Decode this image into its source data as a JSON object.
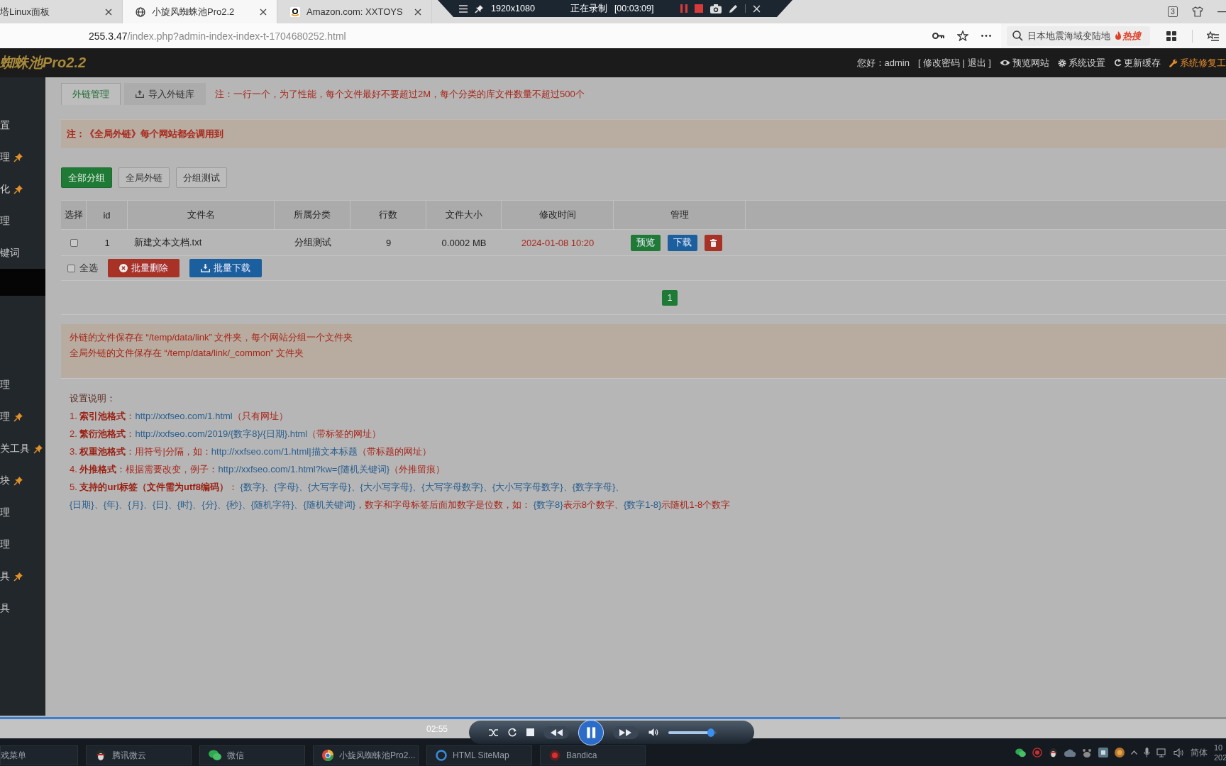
{
  "browser": {
    "tabs": [
      {
        "title": "塔Linux面板",
        "kind": "plain",
        "selected": false
      },
      {
        "title": "小旋风蜘蛛池Pro2.2",
        "kind": "web",
        "selected": true
      },
      {
        "title": "Amazon.com: XXTOYS",
        "kind": "store",
        "selected": false
      }
    ],
    "address": {
      "host": "255.3.47",
      "path": "/index.php?admin-index-index-t-1704680252.html"
    },
    "search": {
      "value": "日本地震海域变陆地",
      "hot_label": "热搜"
    },
    "window_badge": "3"
  },
  "recorder": {
    "resolution": "1920x1080",
    "status": "正在录制",
    "elapsed": "[00:03:09]"
  },
  "admin": {
    "logo": "蜘蛛池Pro2.2",
    "greeting": "您好：admin",
    "account": "[ 修改密码 | 退出 ]",
    "links": [
      {
        "kind": "preview",
        "label": "预览网站"
      },
      {
        "kind": "settings",
        "label": "系统设置"
      },
      {
        "kind": "refresh",
        "label": "更新缓存"
      },
      {
        "kind": "repair",
        "label": "系统修复工"
      }
    ]
  },
  "sidebar": {
    "items": [
      {
        "label": "置",
        "pinned": false,
        "selected": false
      },
      {
        "label": "理",
        "pinned": true,
        "selected": false
      },
      {
        "label": "化",
        "pinned": true,
        "selected": false
      },
      {
        "label": "理",
        "pinned": false,
        "selected": false
      },
      {
        "label": "键词",
        "pinned": false,
        "selected": false
      },
      {
        "pinned": false,
        "selected": true
      },
      {
        "label": "理",
        "pinned": false,
        "selected": false
      },
      {
        "label": "理",
        "pinned": true,
        "selected": false
      },
      {
        "label": "关工具",
        "pinned": true,
        "selected": false
      },
      {
        "label": "块",
        "pinned": true,
        "selected": false
      },
      {
        "label": "理",
        "pinned": false,
        "selected": false
      },
      {
        "label": "理",
        "pinned": false,
        "selected": false
      },
      {
        "label": "具",
        "pinned": true,
        "selected": false
      },
      {
        "label": "具",
        "pinned": false,
        "selected": false
      }
    ]
  },
  "content": {
    "tabs": [
      {
        "label": "外链管理",
        "kind": "list",
        "selected": true
      },
      {
        "label": "导入外链库",
        "kind": "import",
        "selected": false
      }
    ],
    "tabs_note": "注：一行一个，为了性能，每个文件最好不要超过2M，每个分类的库文件数量不超过500个",
    "notice": "注：《全局外链》每个网站都会调用到",
    "filters": [
      {
        "label": "全部分组",
        "selected": true
      },
      {
        "label": "全局外链",
        "selected": false
      },
      {
        "label": "分组测试",
        "selected": false
      }
    ],
    "table": {
      "columns": [
        "选择",
        "id",
        "文件名",
        "所属分类",
        "行数",
        "文件大小",
        "修改时间",
        "管理"
      ],
      "rows": [
        {
          "checked": false,
          "id": "1",
          "file": "新建文本文档.txt",
          "category": "分组测试",
          "lines": "9",
          "size": "0.0002 MB",
          "modified": "2024-01-08 10:20",
          "actions": [
            {
              "kind": "preview",
              "label": "预览"
            },
            {
              "kind": "download",
              "label": "下载"
            },
            {
              "kind": "delete"
            }
          ]
        }
      ],
      "select_all": {
        "label": "全选",
        "checked": false
      },
      "bulk_actions": [
        {
          "kind": "delete",
          "label": "批量删除"
        },
        {
          "kind": "download",
          "label": "批量下载"
        }
      ]
    },
    "pagination": [
      {
        "label": "1",
        "selected": true
      }
    ],
    "storage_info": [
      "外链的文件保存在 “/temp/data/link” 文件夹，每个网站分组一个文件夹",
      "全局外链的文件保存在 “/temp/data/link/_common” 文件夹"
    ],
    "settings": {
      "title": "设置说明：",
      "lines": [
        {
          "segments": [
            {
              "kind": "plain",
              "text": "1. "
            },
            {
              "kind": "label",
              "text": "索引池格式"
            },
            {
              "kind": "plain",
              "text": "："
            },
            {
              "kind": "value",
              "text": "http://xxfseo.com/1.html"
            },
            {
              "kind": "plain",
              "text": "（只有网址）"
            }
          ]
        },
        {
          "segments": [
            {
              "kind": "plain",
              "text": "2. "
            },
            {
              "kind": "label",
              "text": "繁衍池格式"
            },
            {
              "kind": "plain",
              "text": "："
            },
            {
              "kind": "value",
              "text": "http://xxfseo.com/2019/{数字8}/{日期}.html"
            },
            {
              "kind": "plain",
              "text": "（带标签的网址）"
            }
          ]
        },
        {
          "segments": [
            {
              "kind": "plain",
              "text": "3. "
            },
            {
              "kind": "label",
              "text": "权重池格式"
            },
            {
              "kind": "plain",
              "text": "：用符号|分隔，如："
            },
            {
              "kind": "value",
              "text": "http://xxfseo.com/1.html|描文本标题"
            },
            {
              "kind": "plain",
              "text": "（带标题的网址）"
            }
          ]
        },
        {
          "segments": [
            {
              "kind": "plain",
              "text": "4. "
            },
            {
              "kind": "label",
              "text": "外推格式"
            },
            {
              "kind": "plain",
              "text": "：根据需要改变，例子："
            },
            {
              "kind": "value",
              "text": "http://xxfseo.com/1.html?kw={随机关键词}"
            },
            {
              "kind": "plain",
              "text": "（外推留痕）"
            }
          ]
        },
        {
          "segments": [
            {
              "kind": "plain",
              "text": "5. "
            },
            {
              "kind": "label",
              "text": "支持的url标签（文件需为utf8编码）"
            },
            {
              "kind": "plain",
              "text": "： "
            },
            {
              "kind": "value",
              "text": "{数字}、{字母}、{大写字母}、{大小写字母}、{大写字母数字}、{大小写字母数字}、{数字字母}、"
            },
            {
              "kind": "break"
            },
            {
              "kind": "value",
              "text": "{日期}、{年}、{月}、{日}、{时}、{分}、{秒}、{随机字符}、{随机关键词}"
            },
            {
              "kind": "plain",
              "text": "，数字和字母标签后面加数字是位数，如： "
            },
            {
              "kind": "value",
              "text": "{数字8}"
            },
            {
              "kind": "plain",
              "text": "表示8个数字、"
            },
            {
              "kind": "value",
              "text": "{数字1-8}"
            },
            {
              "kind": "plain",
              "text": "示随机1-8个数字"
            }
          ]
        }
      ]
    }
  },
  "player": {
    "seek": {
      "level": 0.685
    },
    "time": "02:55",
    "playing": true,
    "volume": {
      "level": 0.88
    }
  },
  "taskbar": {
    "items": [
      {
        "label": "戏菜单",
        "kind": "menu"
      },
      {
        "label": "腾讯微云",
        "kind": "cloud"
      },
      {
        "label": "微信",
        "kind": "chat"
      },
      {
        "label": "小旋风蜘蛛池Pro2...",
        "kind": "browser"
      },
      {
        "label": "HTML SiteMap",
        "kind": "sitemap"
      },
      {
        "label": "Bandica",
        "kind": "recorder"
      }
    ],
    "language": "简体",
    "clock_time": "10",
    "clock_date": "202"
  }
}
